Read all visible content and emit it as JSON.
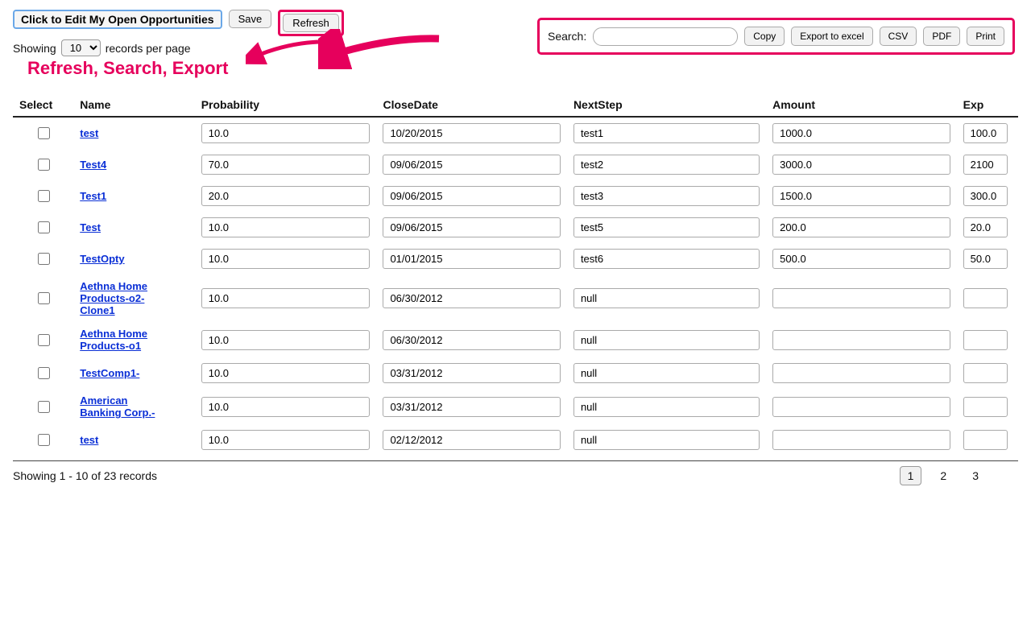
{
  "header": {
    "title_button": "Click to Edit My Open Opportunities",
    "save_label": "Save",
    "refresh_label": "Refresh",
    "showing_prefix": "Showing",
    "records_select": "10",
    "records_suffix": "records per page"
  },
  "annotation": {
    "text": "Refresh, Search, Export"
  },
  "search": {
    "label": "Search:",
    "value": "",
    "copy": "Copy",
    "export_excel": "Export to excel",
    "csv": "CSV",
    "pdf": "PDF",
    "print": "Print"
  },
  "columns": {
    "select": "Select",
    "name": "Name",
    "probability": "Probability",
    "closedate": "CloseDate",
    "nextstep": "NextStep",
    "amount": "Amount",
    "exp": "Exp"
  },
  "rows": [
    {
      "name": "test",
      "probability": "10.0",
      "closedate": "10/20/2015",
      "nextstep": "test1",
      "amount": "1000.0",
      "exp": "100.0"
    },
    {
      "name": "Test4",
      "probability": "70.0",
      "closedate": "09/06/2015",
      "nextstep": "test2",
      "amount": "3000.0",
      "exp": "2100"
    },
    {
      "name": "Test1",
      "probability": "20.0",
      "closedate": "09/06/2015",
      "nextstep": "test3",
      "amount": "1500.0",
      "exp": "300.0"
    },
    {
      "name": "Test",
      "probability": "10.0",
      "closedate": "09/06/2015",
      "nextstep": "test5",
      "amount": "200.0",
      "exp": "20.0"
    },
    {
      "name": "TestOpty",
      "probability": "10.0",
      "closedate": "01/01/2015",
      "nextstep": "test6",
      "amount": "500.0",
      "exp": "50.0"
    },
    {
      "name": "Aethna Home Products-o2-Clone1",
      "probability": "10.0",
      "closedate": "06/30/2012",
      "nextstep": "null",
      "amount": "",
      "exp": ""
    },
    {
      "name": "Aethna Home Products-o1",
      "probability": "10.0",
      "closedate": "06/30/2012",
      "nextstep": "null",
      "amount": "",
      "exp": ""
    },
    {
      "name": "TestComp1-",
      "probability": "10.0",
      "closedate": "03/31/2012",
      "nextstep": "null",
      "amount": "",
      "exp": ""
    },
    {
      "name": "American Banking Corp.-",
      "probability": "10.0",
      "closedate": "03/31/2012",
      "nextstep": "null",
      "amount": "",
      "exp": ""
    },
    {
      "name": "test",
      "probability": "10.0",
      "closedate": "02/12/2012",
      "nextstep": "null",
      "amount": "",
      "exp": ""
    }
  ],
  "footer": {
    "showing": "Showing 1 - 10 of 23 records",
    "pages": [
      "1",
      "2",
      "3"
    ],
    "active_page": "1"
  }
}
